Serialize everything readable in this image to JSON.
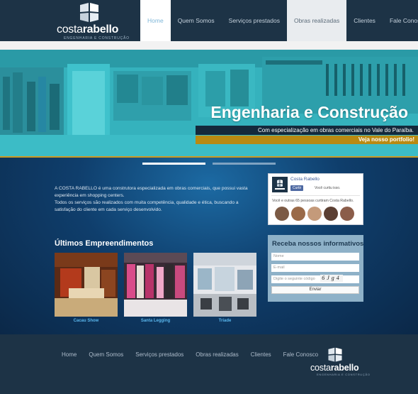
{
  "brand": {
    "name_part1": "costa",
    "name_part2": "rabello",
    "tagline": "ENGENHARIA E CONSTRUÇÃO",
    "footer_tagline": "ENGENHARIA E CONSTRUÇÃO"
  },
  "nav": {
    "items": [
      {
        "label": "Home"
      },
      {
        "label": "Quem Somos"
      },
      {
        "label": "Serviços prestados"
      },
      {
        "label": "Obras realizadas"
      },
      {
        "label": "Clientes"
      },
      {
        "label": "Fale Conosco"
      }
    ]
  },
  "hero": {
    "title": "Engenharia e Construção",
    "subtitle": "Com especialização em obras comerciais no Vale do Paraíba.",
    "cta": "Veja nosso portfolio!"
  },
  "intro": {
    "line1": "A COSTA RABELLO é uma construtora especializada em obras comerciais, que possui vasta experiência em shopping centers.",
    "line2": "Todos os serviços são realizados com muita competência, qualidade e ética, buscando a satisfação do cliente em cada serviço desenvolvido."
  },
  "facebook": {
    "page_name": "Costa Rabello",
    "like_label": "Curtir",
    "like_note": "Você curtiu isso.",
    "count_text": "Você e outras 65 pessoas curtiram Costa Rabello."
  },
  "newsletter": {
    "title": "Receba nossos informativos",
    "name_placeholder": "Nome",
    "email_placeholder": "E-mail",
    "captcha_placeholder": "Digite o seguinte código",
    "captcha_code": "6Jg4",
    "submit_label": "Enviar"
  },
  "projects": {
    "title": "Últimos Empreendimentos",
    "items": [
      {
        "caption": "Cacau Show"
      },
      {
        "caption": "Santa Legging"
      },
      {
        "caption": "Triade"
      }
    ]
  },
  "footer_nav": {
    "items": [
      {
        "label": "Home"
      },
      {
        "label": "Quem Somos"
      },
      {
        "label": "Serviços prestados"
      },
      {
        "label": "Obras realizadas"
      },
      {
        "label": "Clientes"
      },
      {
        "label": "Fale Conosco"
      }
    ]
  },
  "colors": {
    "header_bg": "#1d3346",
    "hero_teal": "#2fa9b5",
    "cta_gold": "#b98a12",
    "accent_blue": "#5ab6ec",
    "main_blue": "#0f3e6c"
  }
}
